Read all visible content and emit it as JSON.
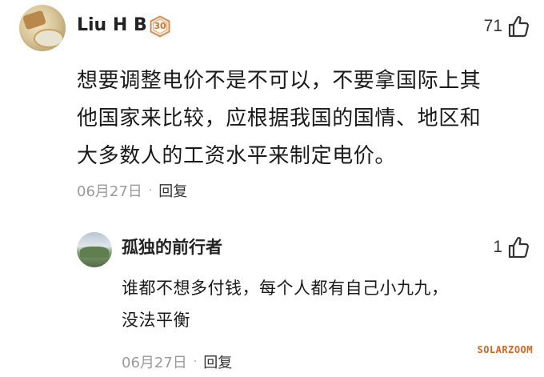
{
  "main_comment": {
    "username": "Liu H B",
    "level": "30",
    "like_count": "71",
    "content": "想要调整电价不是不可以，不要拿国际上其\n他国家来比较，应根据我国的国情、地区和\n大多数人的工资水平来制定电价。",
    "date": "06月27日",
    "separator": "·",
    "reply_label": "回复"
  },
  "reply_comment": {
    "username": "孤独的前行者",
    "like_count": "1",
    "content": "谁都不想多付钱，每个人都有自己小九九，\n没法平衡",
    "date": "06月27日",
    "separator": "·",
    "reply_label": "回复"
  },
  "watermark": "SOLARZOOM",
  "icons": {
    "like": "thumbs-up-outline-icon",
    "level_badge": "hexagon-level-badge-icon"
  },
  "colors": {
    "badge": "#c8763a",
    "watermark": "#e0631d",
    "meta_text": "#9a9a9a"
  }
}
